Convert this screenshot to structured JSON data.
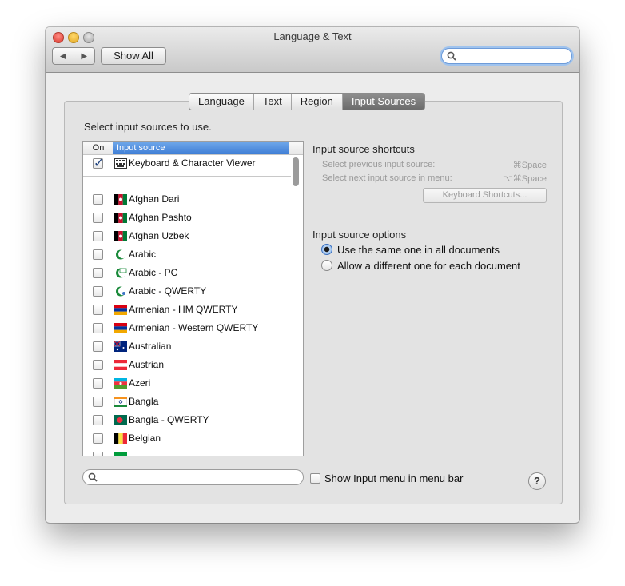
{
  "window": {
    "title": "Language & Text",
    "nav_back": "◀",
    "nav_forward": "▶",
    "show_all": "Show All",
    "search_placeholder": ""
  },
  "tabs": [
    {
      "label": "Language",
      "active": false
    },
    {
      "label": "Text",
      "active": false
    },
    {
      "label": "Region",
      "active": false
    },
    {
      "label": "Input Sources",
      "active": true
    }
  ],
  "instruction": "Select input sources to use.",
  "list": {
    "col_on": "On",
    "col_source": "Input source",
    "pinned": {
      "label": "Keyboard & Character Viewer",
      "checked": true,
      "icon": "keyboard-viewer-icon"
    },
    "items": [
      {
        "label": "Afghan Dari",
        "checked": false,
        "icon": "afghanistan-flag-icon"
      },
      {
        "label": "Afghan Pashto",
        "checked": false,
        "icon": "afghanistan-flag-icon"
      },
      {
        "label": "Afghan Uzbek",
        "checked": false,
        "icon": "afghanistan-flag-icon"
      },
      {
        "label": "Arabic",
        "checked": false,
        "icon": "crescent-icon"
      },
      {
        "label": "Arabic - PC",
        "checked": false,
        "icon": "crescent-icon"
      },
      {
        "label": "Arabic - QWERTY",
        "checked": false,
        "icon": "crescent-icon"
      },
      {
        "label": "Armenian - HM QWERTY",
        "checked": false,
        "icon": "armenia-flag-icon"
      },
      {
        "label": "Armenian - Western QWERTY",
        "checked": false,
        "icon": "armenia-flag-icon"
      },
      {
        "label": "Australian",
        "checked": false,
        "icon": "australia-flag-icon"
      },
      {
        "label": "Austrian",
        "checked": false,
        "icon": "austria-flag-icon"
      },
      {
        "label": "Azeri",
        "checked": false,
        "icon": "azerbaijan-flag-icon"
      },
      {
        "label": "Bangla",
        "checked": false,
        "icon": "bangla-script-icon"
      },
      {
        "label": "Bangla - QWERTY",
        "checked": false,
        "icon": "bangladesh-flag-icon"
      },
      {
        "label": "Belgian",
        "checked": false,
        "icon": "belgium-flag-icon"
      }
    ]
  },
  "shortcuts": {
    "heading": "Input source shortcuts",
    "prev_label": "Select previous input source:",
    "prev_key": "⌘Space",
    "next_label": "Select next input source in menu:",
    "next_key": "⌥⌘Space",
    "button": "Keyboard Shortcuts..."
  },
  "options": {
    "heading": "Input source options",
    "same": "Use the same one in all documents",
    "different": "Allow a different one for each document",
    "selected": "same"
  },
  "bottom": {
    "search_placeholder": "",
    "show_menu_label": "Show Input menu in menu bar",
    "show_menu_checked": false,
    "help": "?"
  },
  "colors": {
    "accent": "#3f7ed6",
    "selection": "#6fa8ea",
    "window_bg": "#ececec"
  }
}
